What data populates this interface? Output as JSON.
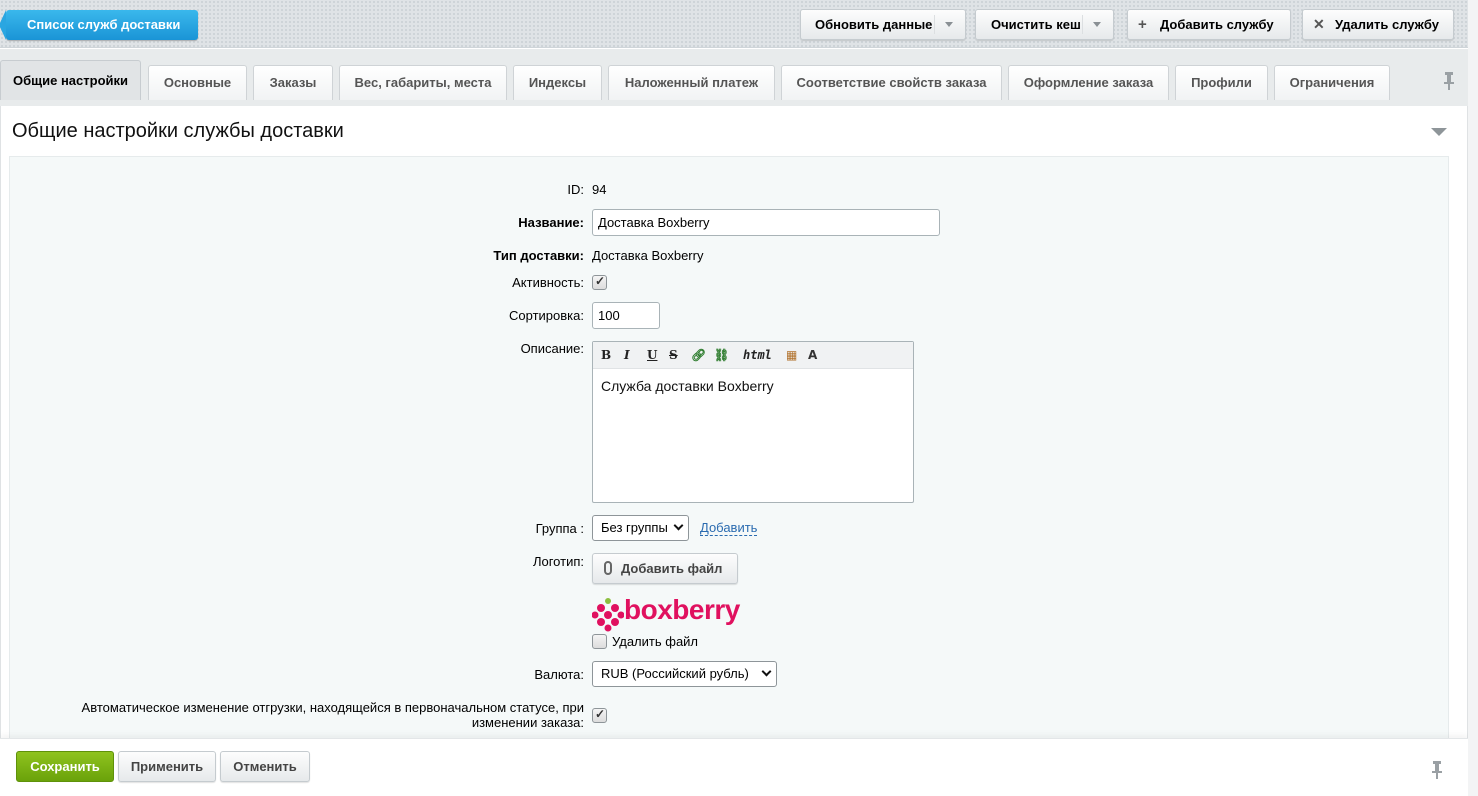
{
  "toolbar": {
    "back_label": "Список служб доставки",
    "refresh_label": "Обновить данные",
    "clear_cache_label": "Очистить кеш",
    "add_service_label": "Добавить службу",
    "delete_service_label": "Удалить службу",
    "add_icon": "plus-icon",
    "delete_icon": "close-icon"
  },
  "tabs": [
    {
      "label": "Общие настройки",
      "active": true
    },
    {
      "label": "Основные"
    },
    {
      "label": "Заказы"
    },
    {
      "label": "Вес, габариты, места"
    },
    {
      "label": "Индексы"
    },
    {
      "label": "Наложенный платеж"
    },
    {
      "label": "Соответствие свойств заказа"
    },
    {
      "label": "Оформление заказа"
    },
    {
      "label": "Профили"
    },
    {
      "label": "Ограничения"
    }
  ],
  "section": {
    "title": "Общие настройки службы доставки"
  },
  "form": {
    "id_label": "ID:",
    "id_value": "94",
    "name_label": "Название:",
    "name_value": "Доставка Boxberry",
    "type_label": "Тип доставки:",
    "type_value": "Доставка Boxberry",
    "active_label": "Активность:",
    "active_checked": true,
    "sort_label": "Сортировка:",
    "sort_value": "100",
    "description_label": "Описание:",
    "description_value": "Служба доставки Boxberry",
    "editor_html_label": "html",
    "group_label": "Группа :",
    "group_value": "Без группы",
    "group_add_link": "Добавить",
    "logo_label": "Логотип:",
    "add_file_label": "Добавить файл",
    "logo_text": "boxberry",
    "delete_file_label": "Удалить файл",
    "delete_file_checked": false,
    "currency_label": "Валюта:",
    "currency_value": "RUB (Российский рубль)",
    "auto_change_label_line1": "Автоматическое изменение отгрузки, находящейся в первоначальном статусе, при",
    "auto_change_label_line2": "изменении заказа:",
    "auto_change_checked": true
  },
  "footer": {
    "save_label": "Сохранить",
    "apply_label": "Применить",
    "cancel_label": "Отменить"
  },
  "colors": {
    "accent_blue": "#1a94d6",
    "save_green": "#6aa20a",
    "brand_boxberry": "#e0115f"
  }
}
